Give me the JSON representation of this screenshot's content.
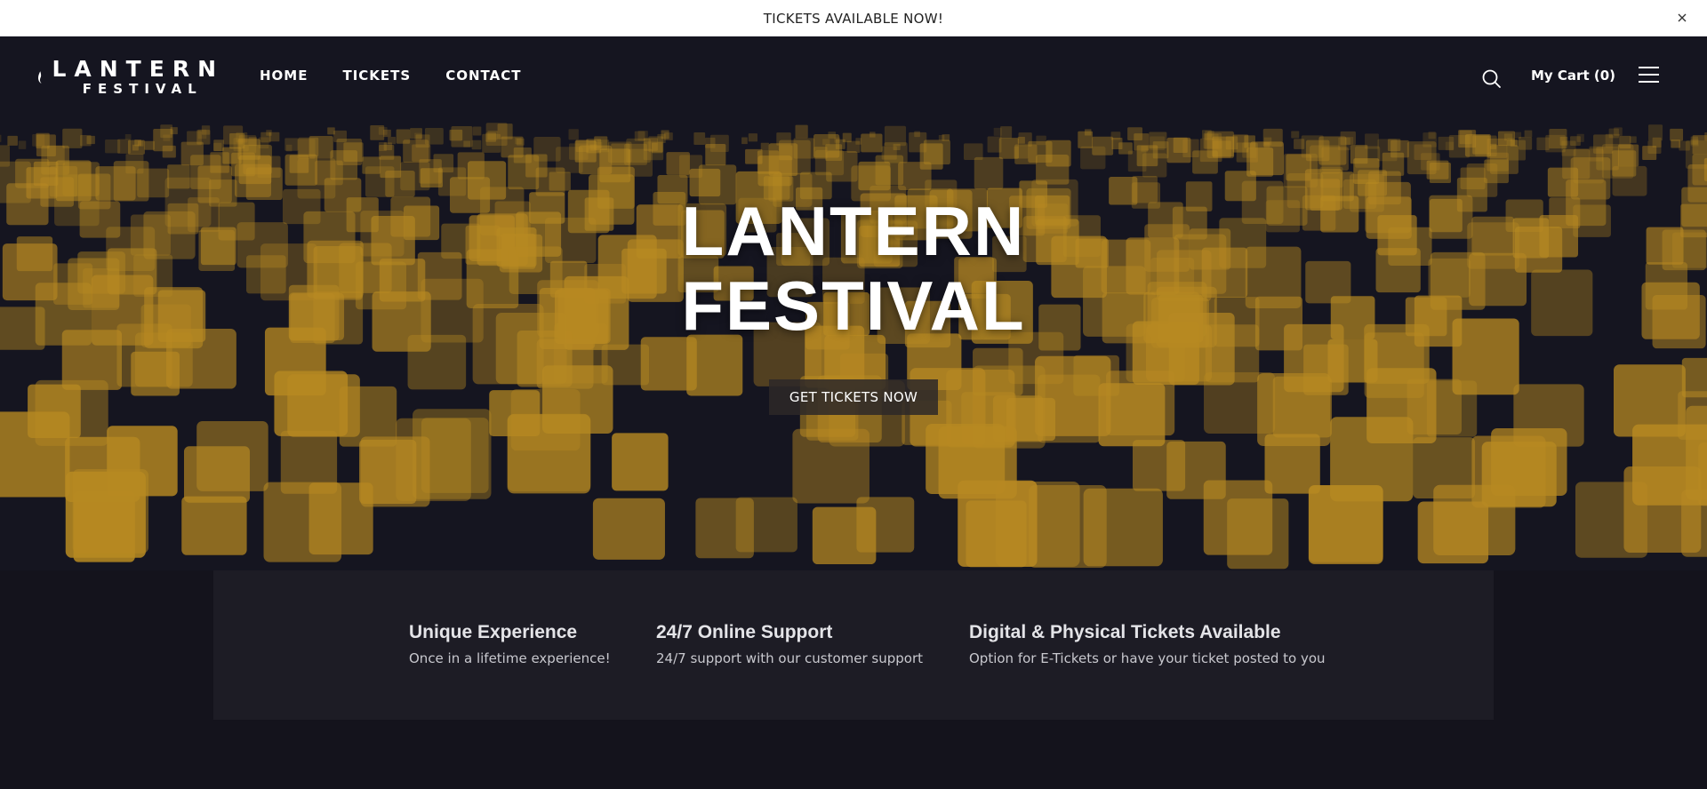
{
  "announcement": {
    "text": "TICKETS AVAILABLE NOW!"
  },
  "logo": {
    "line1": "LANTERN",
    "line2": "FESTIVAL"
  },
  "nav": {
    "items": [
      {
        "label": "HOME"
      },
      {
        "label": "TICKETS"
      },
      {
        "label": "CONTACT"
      }
    ]
  },
  "header": {
    "cart_label": "My Cart (0)"
  },
  "hero": {
    "title_line1": "LANTERN",
    "title_line2": "FESTIVAL",
    "button_label": "GET TICKETS NOW"
  },
  "features": [
    {
      "title": "Unique Experience",
      "description": "Once in a lifetime experience!"
    },
    {
      "title": "24/7 Online Support",
      "description": "24/7 support with our customer support"
    },
    {
      "title": "Digital & Physical Tickets Available",
      "description": "Option for E-Tickets or have your ticket posted to you"
    }
  ],
  "colors": {
    "page_bg": "#14131c",
    "features_bg": "#1d1c25",
    "lantern_glow": "#e0a82a",
    "announcement_bg": "#ffffff"
  }
}
